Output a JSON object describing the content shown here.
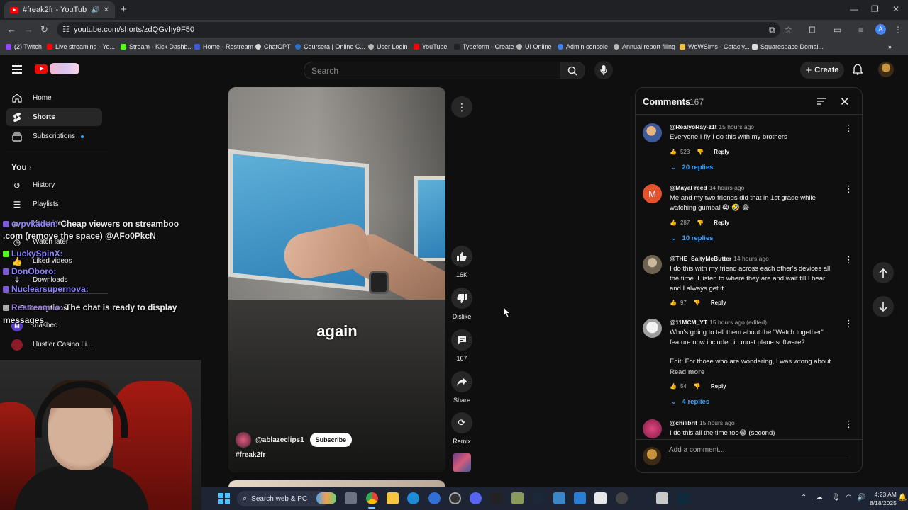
{
  "browser": {
    "tab_title": "#freak2fr - YouTube",
    "url": "youtube.com/shorts/zdQGvhy9F50",
    "profile_letter": "A",
    "bookmarks": [
      "(2) Twitch",
      "Live streaming - Yo...",
      "Stream - Kick Dashb...",
      "Home - Restream",
      "ChatGPT",
      "Coursera | Online C...",
      "User Login",
      "YouTube",
      "Typeform - Create",
      "UI Online",
      "Admin console",
      "Annual report filing",
      "WoWSims - Catacly...",
      "Squarespace Domai..."
    ]
  },
  "header": {
    "search_placeholder": "Search",
    "create_label": "Create"
  },
  "sidebar": {
    "items": [
      {
        "label": "Home",
        "icon": "home-icon"
      },
      {
        "label": "Shorts",
        "icon": "shorts-icon"
      },
      {
        "label": "Subscriptions",
        "icon": "subscriptions-icon"
      }
    ],
    "you_label": "You",
    "you_items": [
      {
        "label": "History"
      },
      {
        "label": "Playlists"
      },
      {
        "label": "Your videos"
      },
      {
        "label": "Watch later"
      },
      {
        "label": "Liked videos"
      },
      {
        "label": "Downloads"
      }
    ],
    "subscriptions_label": "Subscriptions",
    "subscriptions": [
      {
        "label": "mashed"
      },
      {
        "label": "Hustler Casino Li..."
      }
    ]
  },
  "chat_overlay": [
    {
      "user": "cvpvkaden:",
      "text": "Cheap viewers on streamboo"
    },
    {
      "user": "",
      "text": ".com (remove the space) @AFo0PkcN"
    },
    {
      "user": "LuckySpinX:",
      "text": ""
    },
    {
      "user": "DonOboro:",
      "text": ""
    },
    {
      "user": "Nuclearsupernova:",
      "text": ""
    },
    {
      "user": "Restream.io:",
      "text": "The chat is ready to display"
    },
    {
      "user": "",
      "text": "messages."
    }
  ],
  "short": {
    "caption": "again",
    "channel": "@ablazeclips1",
    "subscribe_label": "Subscribe",
    "hashtag": "#freak2fr",
    "likes": "16K",
    "dislike_label": "Dislike",
    "comments_count": "167",
    "share_label": "Share",
    "remix_label": "Remix"
  },
  "comments": {
    "title": "Comments",
    "count": "167",
    "add_placeholder": "Add a comment...",
    "reply_label": "Reply",
    "read_more": "Read more",
    "items": [
      {
        "author": "@RealyoRay-z1t",
        "time": "15 hours ago",
        "text": "Everyone I fly I do this with my brothers",
        "likes": "523",
        "replies": "20 replies",
        "avatar_color": "#5a6fa8"
      },
      {
        "author": "@MayaFreed",
        "time": "14 hours ago",
        "text": "Me and my two friends did that in 1st grade while watching gumball😭 🤣 😂",
        "likes": "287",
        "replies": "10 replies",
        "avatar_color": "#e4532e",
        "avatar_letter": "M"
      },
      {
        "author": "@THE_SaltyMcButter",
        "time": "14 hours ago",
        "text": "I do this with my friend across each other's devices all the time. I listen to where they are and wait till I hear and I always get it.",
        "likes": "97",
        "replies": "",
        "avatar_color": "#7a6e5a"
      },
      {
        "author": "@11MCM_YT",
        "time": "15 hours ago (edited)",
        "text": "Who's going to tell them about the \"Watch together\" feature now included in most plane software?",
        "text2": "Edit: For those who are wondering, I was wrong about ...",
        "likes": "54",
        "replies": "4 replies",
        "avatar_color": "#cfcfcf"
      },
      {
        "author": "@chilibrit",
        "time": "15 hours ago",
        "text": "I do this all the time too😂 (second)",
        "likes": "",
        "replies": "",
        "avatar_color": "#c0306a"
      }
    ]
  },
  "taskbar": {
    "search_label": "Search web & PC",
    "time": "4:23 AM",
    "date": "8/18/2025"
  }
}
